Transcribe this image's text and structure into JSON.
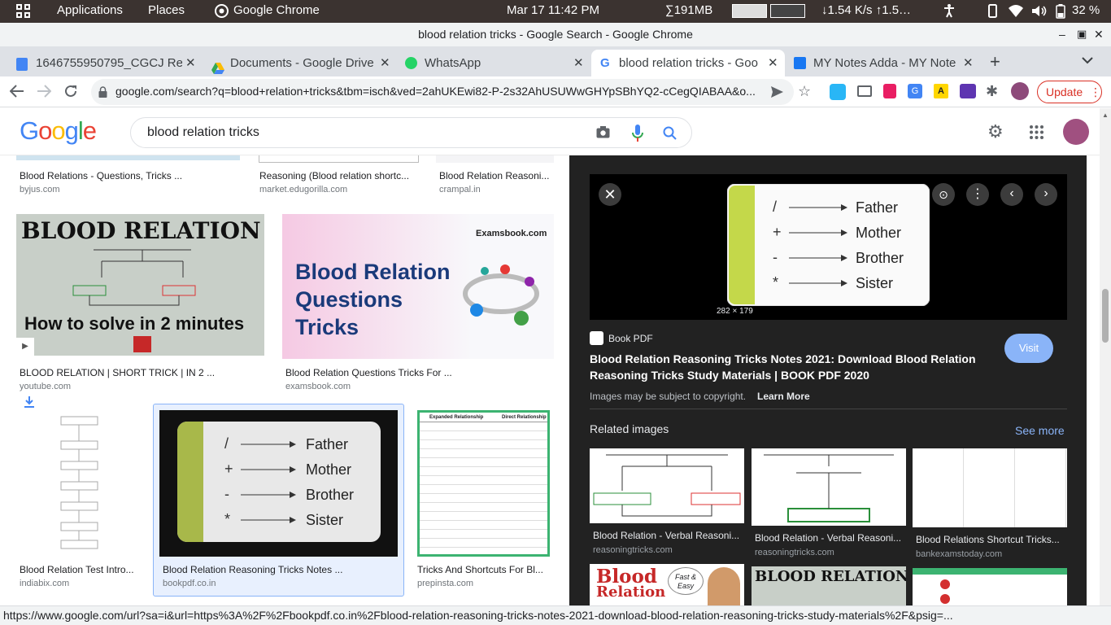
{
  "system_bar": {
    "applications": "Applications",
    "places": "Places",
    "app_name": "Google Chrome",
    "datetime": "Mar 17  11:42 PM",
    "memory": "∑191MB",
    "network": "↓1.54 K/s ↑1.5…",
    "battery": "32 %"
  },
  "window": {
    "title": "blood relation tricks - Google Search - Google Chrome"
  },
  "tabs": [
    {
      "label": "1646755950795_CGCJ Re"
    },
    {
      "label": "Documents - Google Drive"
    },
    {
      "label": "WhatsApp"
    },
    {
      "label": "blood relation tricks - Goo"
    },
    {
      "label": "MY Notes Adda - MY Note"
    }
  ],
  "toolbar": {
    "url": "google.com/search?q=blood+relation+tricks&tbm=isch&ved=2ahUKEwi82-P-2s32AhUSUWwGHYpSBhYQ2-cCegQIABAA&o...",
    "update_label": "Update"
  },
  "search": {
    "logo": "Google",
    "query": "blood relation tricks"
  },
  "results": [
    {
      "caption": "Blood Relations - Questions, Tricks ...",
      "source": "byjus.com"
    },
    {
      "caption": "Reasoning (Blood relation shortc...",
      "source": "market.edugorilla.com"
    },
    {
      "caption": "Blood Relation Reasoni...",
      "source": "crampal.in"
    },
    {
      "caption": "BLOOD RELATION | SHORT TRICK | IN 2 ...",
      "source": "youtube.com"
    },
    {
      "caption": "Blood Relation Questions Tricks For ...",
      "source": "examsbook.com"
    },
    {
      "caption": "Blood Relation Test Intro...",
      "source": "indiabix.com"
    },
    {
      "caption": "Blood Relation Reasoning Tricks Notes ...",
      "source": "bookpdf.co.in"
    },
    {
      "caption": "Tricks And Shortcuts For Bl...",
      "source": "prepinsta.com"
    }
  ],
  "thumbs": {
    "yt_title": "BLOOD RELATION",
    "yt_sub": "How to solve in 2 minutes",
    "exams_brand": "Examsbook.com",
    "exams_l1": "Blood Relation",
    "exams_l2": "Questions",
    "exams_l3": "Tricks",
    "prep_h1": "Expanded Relationship",
    "prep_h2": "Direct Relationship"
  },
  "key_image": {
    "rows": [
      {
        "symbol": "/",
        "relation": "Father"
      },
      {
        "symbol": "+",
        "relation": "Mother"
      },
      {
        "symbol": "-",
        "relation": "Brother"
      },
      {
        "symbol": "*",
        "relation": "Sister"
      }
    ]
  },
  "panel": {
    "dimensions": "282 × 179",
    "site_name": "Book PDF",
    "title": "Blood Relation Reasoning Tricks Notes 2021: Download Blood Relation Reasoning Tricks Study Materials | BOOK PDF 2020",
    "visit_label": "Visit",
    "copyright": "Images may be subject to copyright.",
    "learn_more": "Learn More",
    "related_heading": "Related images",
    "see_more": "See more",
    "related": [
      {
        "caption": "Blood Relation - Verbal Reasoni...",
        "source": "reasoningtricks.com"
      },
      {
        "caption": "Blood Relation - Verbal Reasoni...",
        "source": "reasoningtricks.com"
      },
      {
        "caption": "Blood Relations Shortcut Tricks...",
        "source": "bankexamstoday.com"
      }
    ],
    "bottom_thumbs": {
      "t1_line1": "Blood",
      "t1_line2": "Relation",
      "t1_badge": "Fast & Easy",
      "t2_title": "BLOOD RELATION"
    }
  },
  "status_url": "https://www.google.com/url?sa=i&url=https%3A%2F%2Fbookpdf.co.in%2Fblood-relation-reasoning-tricks-notes-2021-download-blood-relation-reasoning-tricks-study-materials%2F&psig=..."
}
